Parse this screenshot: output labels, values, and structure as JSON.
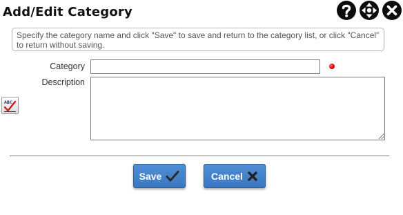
{
  "dialog": {
    "title": "Add/Edit Category",
    "instructions": "Specify the category name and click \"Save\" to save and return to the category list, or click \"Cancel\" to return without saving."
  },
  "header_icons": [
    "help-icon",
    "move-icon",
    "close-icon"
  ],
  "form": {
    "category_label": "Category",
    "category_value": "",
    "description_label": "Description",
    "description_value": "",
    "spellcheck_icon": "spellcheck-icon"
  },
  "buttons": {
    "save_label": "Save",
    "cancel_label": "Cancel"
  },
  "colors": {
    "button_bg": "#3f80cc",
    "required_dot": "#e00000",
    "title_text": "#111111"
  }
}
